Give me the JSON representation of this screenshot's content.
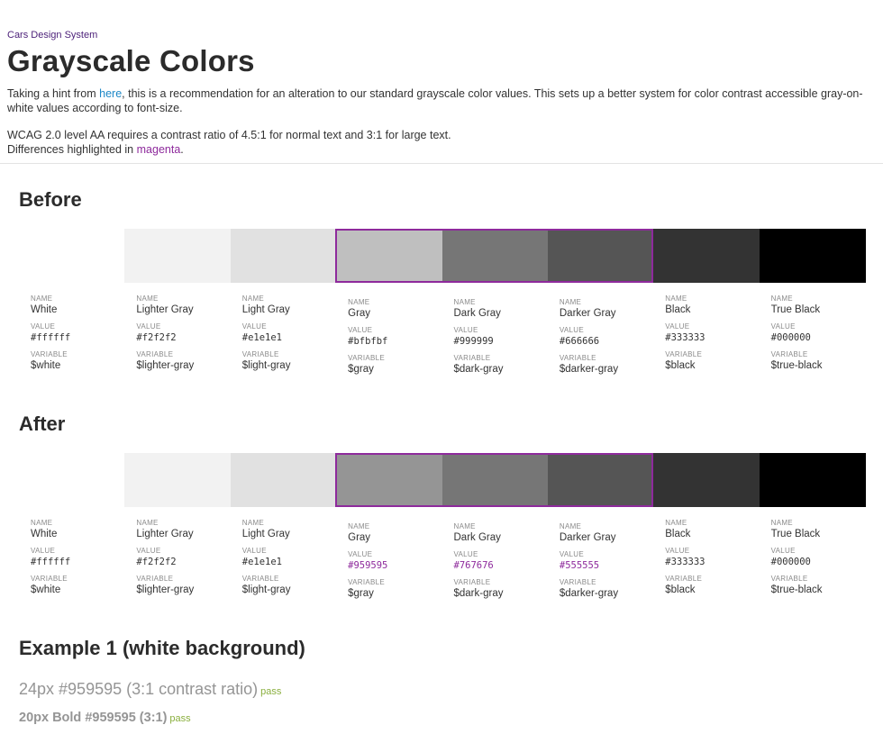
{
  "header": {
    "eyebrow": "Cars Design System",
    "title": "Grayscale Colors",
    "intro_before_link": "Taking a hint from ",
    "intro_link": "here",
    "intro_after_link": ", this is a recommendation for an alteration to our standard grayscale color values. This sets up a better system for color contrast accessible gray-on-white values according to font-size.",
    "wcag_line": "WCAG 2.0 level AA requires a contrast ratio of 4.5:1 for normal text and 3:1 for large text.",
    "diff_before": "Differences highlighted in ",
    "diff_link": "magenta",
    "diff_after": "."
  },
  "labels": {
    "name": "NAME",
    "value": "VALUE",
    "variable": "VARIABLE"
  },
  "highlight_color": "#8e2a9c",
  "before": {
    "title": "Before",
    "swatches": [
      {
        "name": "White",
        "value": "#ffffff",
        "variable": "$white",
        "color": "#ffffff"
      },
      {
        "name": "Lighter Gray",
        "value": "#f2f2f2",
        "variable": "$lighter-gray",
        "color": "#f2f2f2"
      },
      {
        "name": "Light Gray",
        "value": "#e1e1e1",
        "variable": "$light-gray",
        "color": "#e1e1e1"
      },
      {
        "name": "Gray",
        "value": "#bfbfbf",
        "variable": "$gray",
        "color": "#bfbfbf"
      },
      {
        "name": "Dark Gray",
        "value": "#999999",
        "variable": "$dark-gray",
        "color": "#767676"
      },
      {
        "name": "Darker Gray",
        "value": "#666666",
        "variable": "$darker-gray",
        "color": "#555555"
      },
      {
        "name": "Black",
        "value": "#333333",
        "variable": "$black",
        "color": "#333333"
      },
      {
        "name": "True Black",
        "value": "#000000",
        "variable": "$true-black",
        "color": "#000000"
      }
    ]
  },
  "after": {
    "title": "After",
    "swatches": [
      {
        "name": "White",
        "value": "#ffffff",
        "variable": "$white",
        "color": "#ffffff"
      },
      {
        "name": "Lighter Gray",
        "value": "#f2f2f2",
        "variable": "$lighter-gray",
        "color": "#f2f2f2"
      },
      {
        "name": "Light Gray",
        "value": "#e1e1e1",
        "variable": "$light-gray",
        "color": "#e1e1e1"
      },
      {
        "name": "Gray",
        "value": "#959595",
        "variable": "$gray",
        "color": "#959595"
      },
      {
        "name": "Dark Gray",
        "value": "#767676",
        "variable": "$dark-gray",
        "color": "#767676"
      },
      {
        "name": "Darker Gray",
        "value": "#555555",
        "variable": "$darker-gray",
        "color": "#555555"
      },
      {
        "name": "Black",
        "value": "#333333",
        "variable": "$black",
        "color": "#333333"
      },
      {
        "name": "True Black",
        "value": "#000000",
        "variable": "$true-black",
        "color": "#000000"
      }
    ]
  },
  "example": {
    "title": "Example 1 (white background)",
    "line1": "24px #959595 (3:1 contrast ratio)",
    "line1_badge": "pass",
    "line2": "20px Bold #959595 (3:1)",
    "line2_badge": "pass"
  }
}
